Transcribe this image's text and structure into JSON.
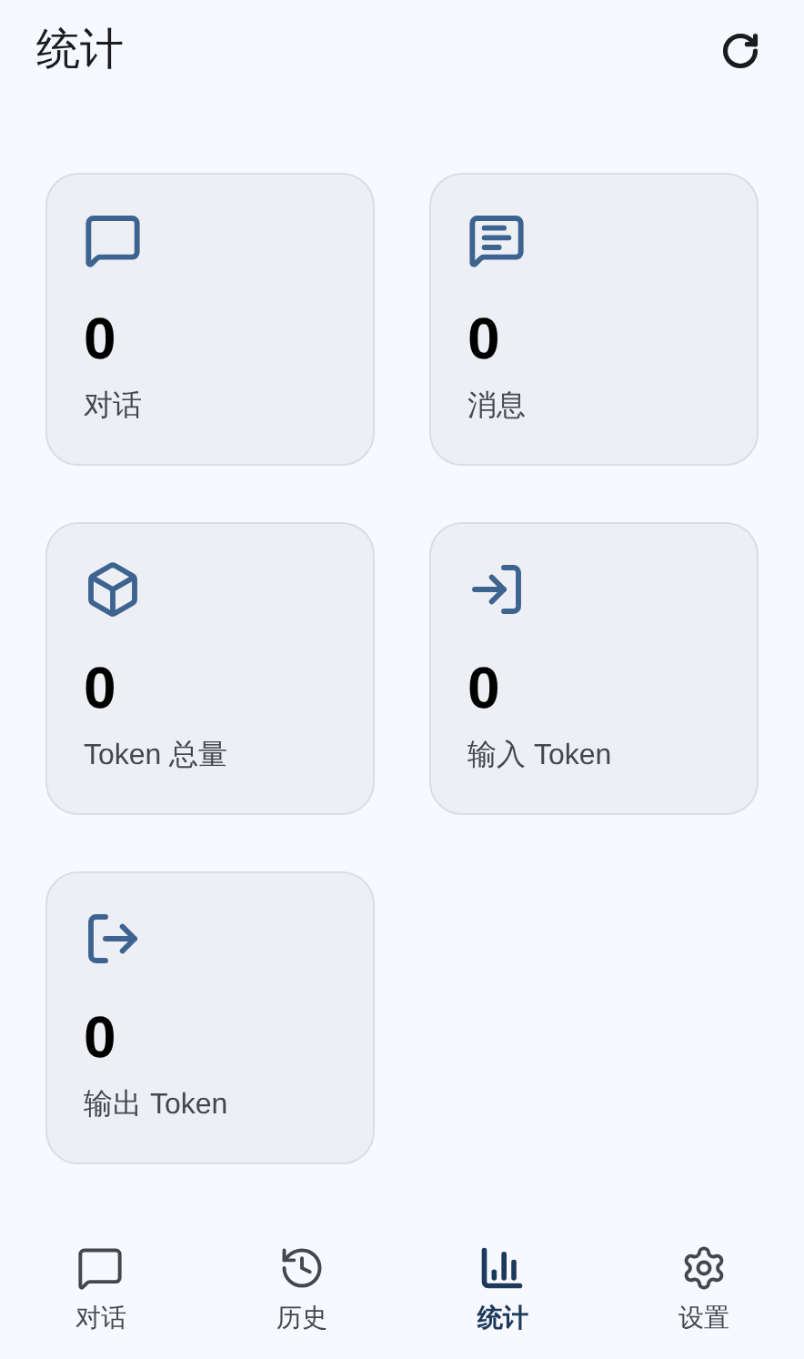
{
  "header": {
    "title": "统计"
  },
  "stats": [
    {
      "kind": "chat",
      "value": "0",
      "label": "对话"
    },
    {
      "kind": "messages",
      "value": "0",
      "label": "消息"
    },
    {
      "kind": "total",
      "value": "0",
      "label": "Token 总量"
    },
    {
      "kind": "input",
      "value": "0",
      "label": "输入 Token"
    },
    {
      "kind": "output",
      "value": "0",
      "label": "输出 Token"
    }
  ],
  "nav": [
    {
      "kind": "chat",
      "label": "对话",
      "selected": false
    },
    {
      "kind": "history",
      "label": "历史",
      "selected": false
    },
    {
      "kind": "stats",
      "label": "统计",
      "selected": true
    },
    {
      "kind": "settings",
      "label": "设置",
      "selected": false
    }
  ]
}
